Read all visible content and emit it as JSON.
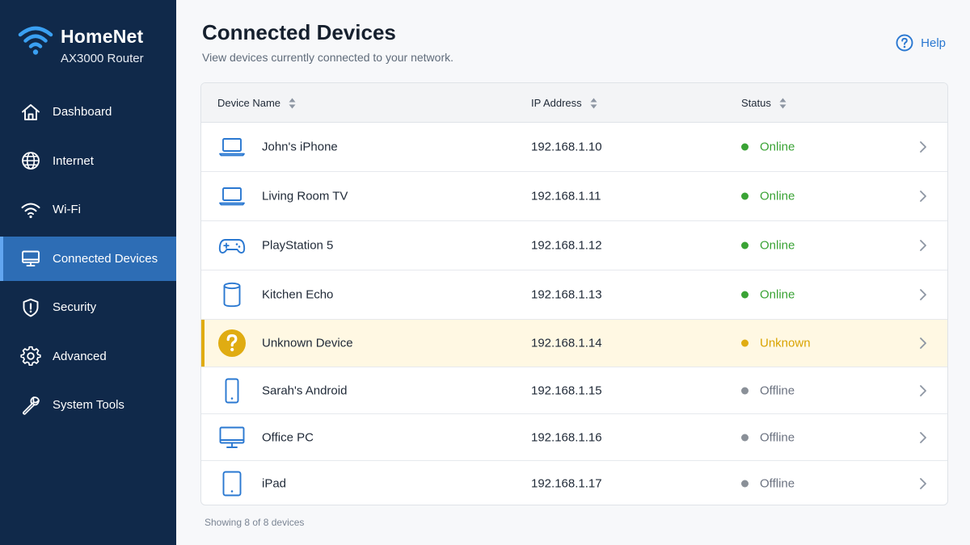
{
  "app": {
    "name": "HomeNet",
    "model": "AX3000 Router"
  },
  "sidebar": {
    "items": [
      {
        "label": "Dashboard",
        "icon": "home-icon",
        "active": false
      },
      {
        "label": "Internet",
        "icon": "globe-icon",
        "active": false
      },
      {
        "label": "Wi-Fi",
        "icon": "wifi-icon",
        "active": false
      },
      {
        "label": "Connected Devices",
        "icon": "monitor-icon",
        "active": true
      },
      {
        "label": "Security",
        "icon": "shield-icon",
        "active": false
      },
      {
        "label": "Advanced",
        "icon": "gear-icon",
        "active": false
      },
      {
        "label": "System Tools",
        "icon": "wrench-icon",
        "active": false
      }
    ]
  },
  "page": {
    "title": "Connected Devices",
    "subtitle": "View devices currently connected to your network.",
    "help_label": "Help"
  },
  "table": {
    "columns": [
      "Device Name",
      "IP Address",
      "Status"
    ],
    "rows": [
      {
        "name": "John's iPhone",
        "ip": "192.168.1.10",
        "status": "Online",
        "icon": "laptop-icon"
      },
      {
        "name": "Living Room TV",
        "ip": "192.168.1.11",
        "status": "Online",
        "icon": "laptop-icon"
      },
      {
        "name": "PlayStation 5",
        "ip": "192.168.1.12",
        "status": "Online",
        "icon": "gamepad-icon"
      },
      {
        "name": "Kitchen Echo",
        "ip": "192.168.1.13",
        "status": "Online",
        "icon": "speaker-icon"
      },
      {
        "name": "Unknown Device",
        "ip": "192.168.1.14",
        "status": "Unknown",
        "icon": "question-icon"
      },
      {
        "name": "Sarah's Android",
        "ip": "192.168.1.15",
        "status": "Offline",
        "icon": "phone-icon"
      },
      {
        "name": "Office PC",
        "ip": "192.168.1.16",
        "status": "Offline",
        "icon": "desktop-icon"
      },
      {
        "name": "iPad",
        "ip": "192.168.1.17",
        "status": "Offline",
        "icon": "tablet-icon"
      }
    ],
    "footer": "Showing 8 of 8 devices"
  },
  "colors": {
    "sidebar_bg": "#10294a",
    "sidebar_active": "#2d6db5",
    "accent": "#2a78d1",
    "online": "#3aa335",
    "unknown": "#d9a300",
    "offline": "#8a9098",
    "warning_row": "#fff8e3",
    "warning_border": "#e0ac12"
  }
}
